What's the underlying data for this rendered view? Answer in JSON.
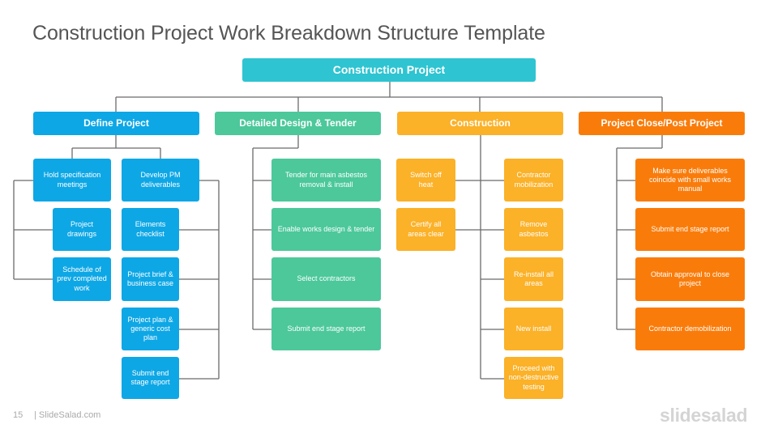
{
  "title": "Construction Project Work Breakdown Structure Template",
  "colors": {
    "root": "#2EC4D1",
    "define": "#0EA7E6",
    "design": "#4CC89B",
    "construction": "#FBB128",
    "close": "#F97C0B",
    "connector": "#6B6B6B"
  },
  "root": {
    "label": "Construction Project"
  },
  "branches": [
    {
      "label": "Define Project",
      "groups": [
        {
          "label": "Hold specification meetings",
          "items": [
            "Project drawings",
            "Schedule of prev completed work"
          ]
        },
        {
          "label": "Develop PM deliverables",
          "items": [
            "Elements checklist",
            "Project brief & business case",
            "Project plan & generic cost plan",
            "Submit end stage report"
          ]
        }
      ]
    },
    {
      "label": "Detailed Design & Tender",
      "items": [
        "Tender for main asbestos removal & install",
        "Enable works design & tender",
        "Select contractors",
        "Submit end stage report"
      ]
    },
    {
      "label": "Construction",
      "left_items": [
        "Switch off heat",
        "Certify all areas clear"
      ],
      "right_items": [
        "Contractor mobilization",
        "Remove asbestos",
        "Re-install all areas",
        "New install",
        "Proceed with non-destructive testing"
      ]
    },
    {
      "label": "Project Close/Post Project",
      "items": [
        "Make sure deliverables coincide with small works manual",
        "Submit end stage report",
        "Obtain approval to close project",
        "Contractor demobilization"
      ]
    }
  ],
  "footer": {
    "page": "15",
    "site": "| SlideSalad.com"
  },
  "logo": "slidesalad"
}
